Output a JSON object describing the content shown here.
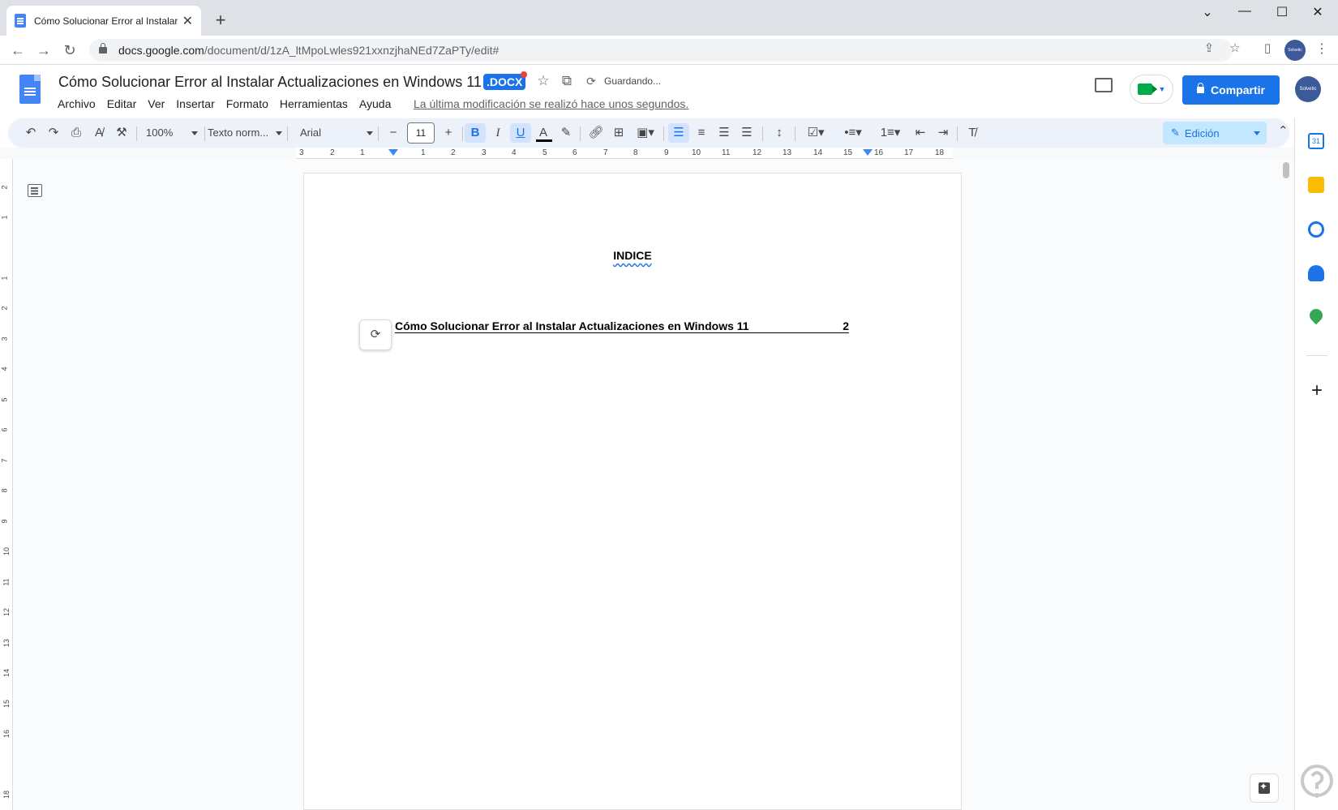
{
  "browser": {
    "tab_title": "Cómo Solucionar Error al Instalar",
    "tab_close": "✕",
    "new_tab": "+",
    "url_domain": "docs.google.com",
    "url_path": "/document/d/1zA_ltMpoLwles921xxnzjhaNEd7ZaPTy/edit#",
    "profile_label": "Solvetic",
    "window_controls": [
      "⌄",
      "—",
      "☐",
      "✕"
    ]
  },
  "docs": {
    "title": "Cómo Solucionar Error al Instalar Actualizaciones en Windows 11",
    "badge": ".DOCX",
    "saving": "Guardando...",
    "menus": [
      "Archivo",
      "Editar",
      "Ver",
      "Insertar",
      "Formato",
      "Herramientas",
      "Ayuda"
    ],
    "last_edit": "La última modificación se realizó hace unos segundos.",
    "share_label": "Compartir",
    "avatar_label": "Solvetic"
  },
  "toolbar": {
    "zoom": "100%",
    "style": "Texto norm...",
    "font": "Arial",
    "font_size": "11",
    "mode": "Edición",
    "text_color": "#000000",
    "accent": "#1a73e8"
  },
  "ruler": {
    "labels": [
      "3",
      "2",
      "1",
      "1",
      "2",
      "3",
      "4",
      "5",
      "6",
      "7",
      "8",
      "9",
      "10",
      "11",
      "12",
      "13",
      "14",
      "15",
      "16",
      "17",
      "18"
    ],
    "vlabels": [
      "2",
      "1",
      "1",
      "2",
      "3",
      "4",
      "5",
      "6",
      "7",
      "8",
      "9",
      "10",
      "11",
      "12",
      "13",
      "14",
      "15",
      "16",
      "18"
    ]
  },
  "document": {
    "heading": "INDICE",
    "toc_entries": [
      {
        "text": "Cómo Solucionar Error al Instalar Actualizaciones en Windows 11",
        "page": "2"
      }
    ]
  },
  "icons": {
    "undo": "undo-icon",
    "redo": "redo-icon",
    "print": "print-icon",
    "spellcheck": "spellcheck-icon",
    "paint_format": "paint-format-icon",
    "bold": "bold-icon",
    "italic": "italic-icon",
    "underline": "underline-icon",
    "text_color": "text-color-icon",
    "highlight": "highlight-icon",
    "link": "link-icon",
    "comment_add": "add-comment-icon",
    "image": "image-icon",
    "align_left": "align-left-icon",
    "align_center": "align-center-icon",
    "align_right": "align-right-icon",
    "justify": "justify-icon",
    "line_spacing": "line-spacing-icon",
    "checklist": "checklist-icon",
    "bullets": "bulleted-list-icon",
    "numbered": "numbered-list-icon",
    "indent_less": "decrease-indent-icon",
    "indent_more": "increase-indent-icon",
    "clear_format": "clear-formatting-icon"
  }
}
